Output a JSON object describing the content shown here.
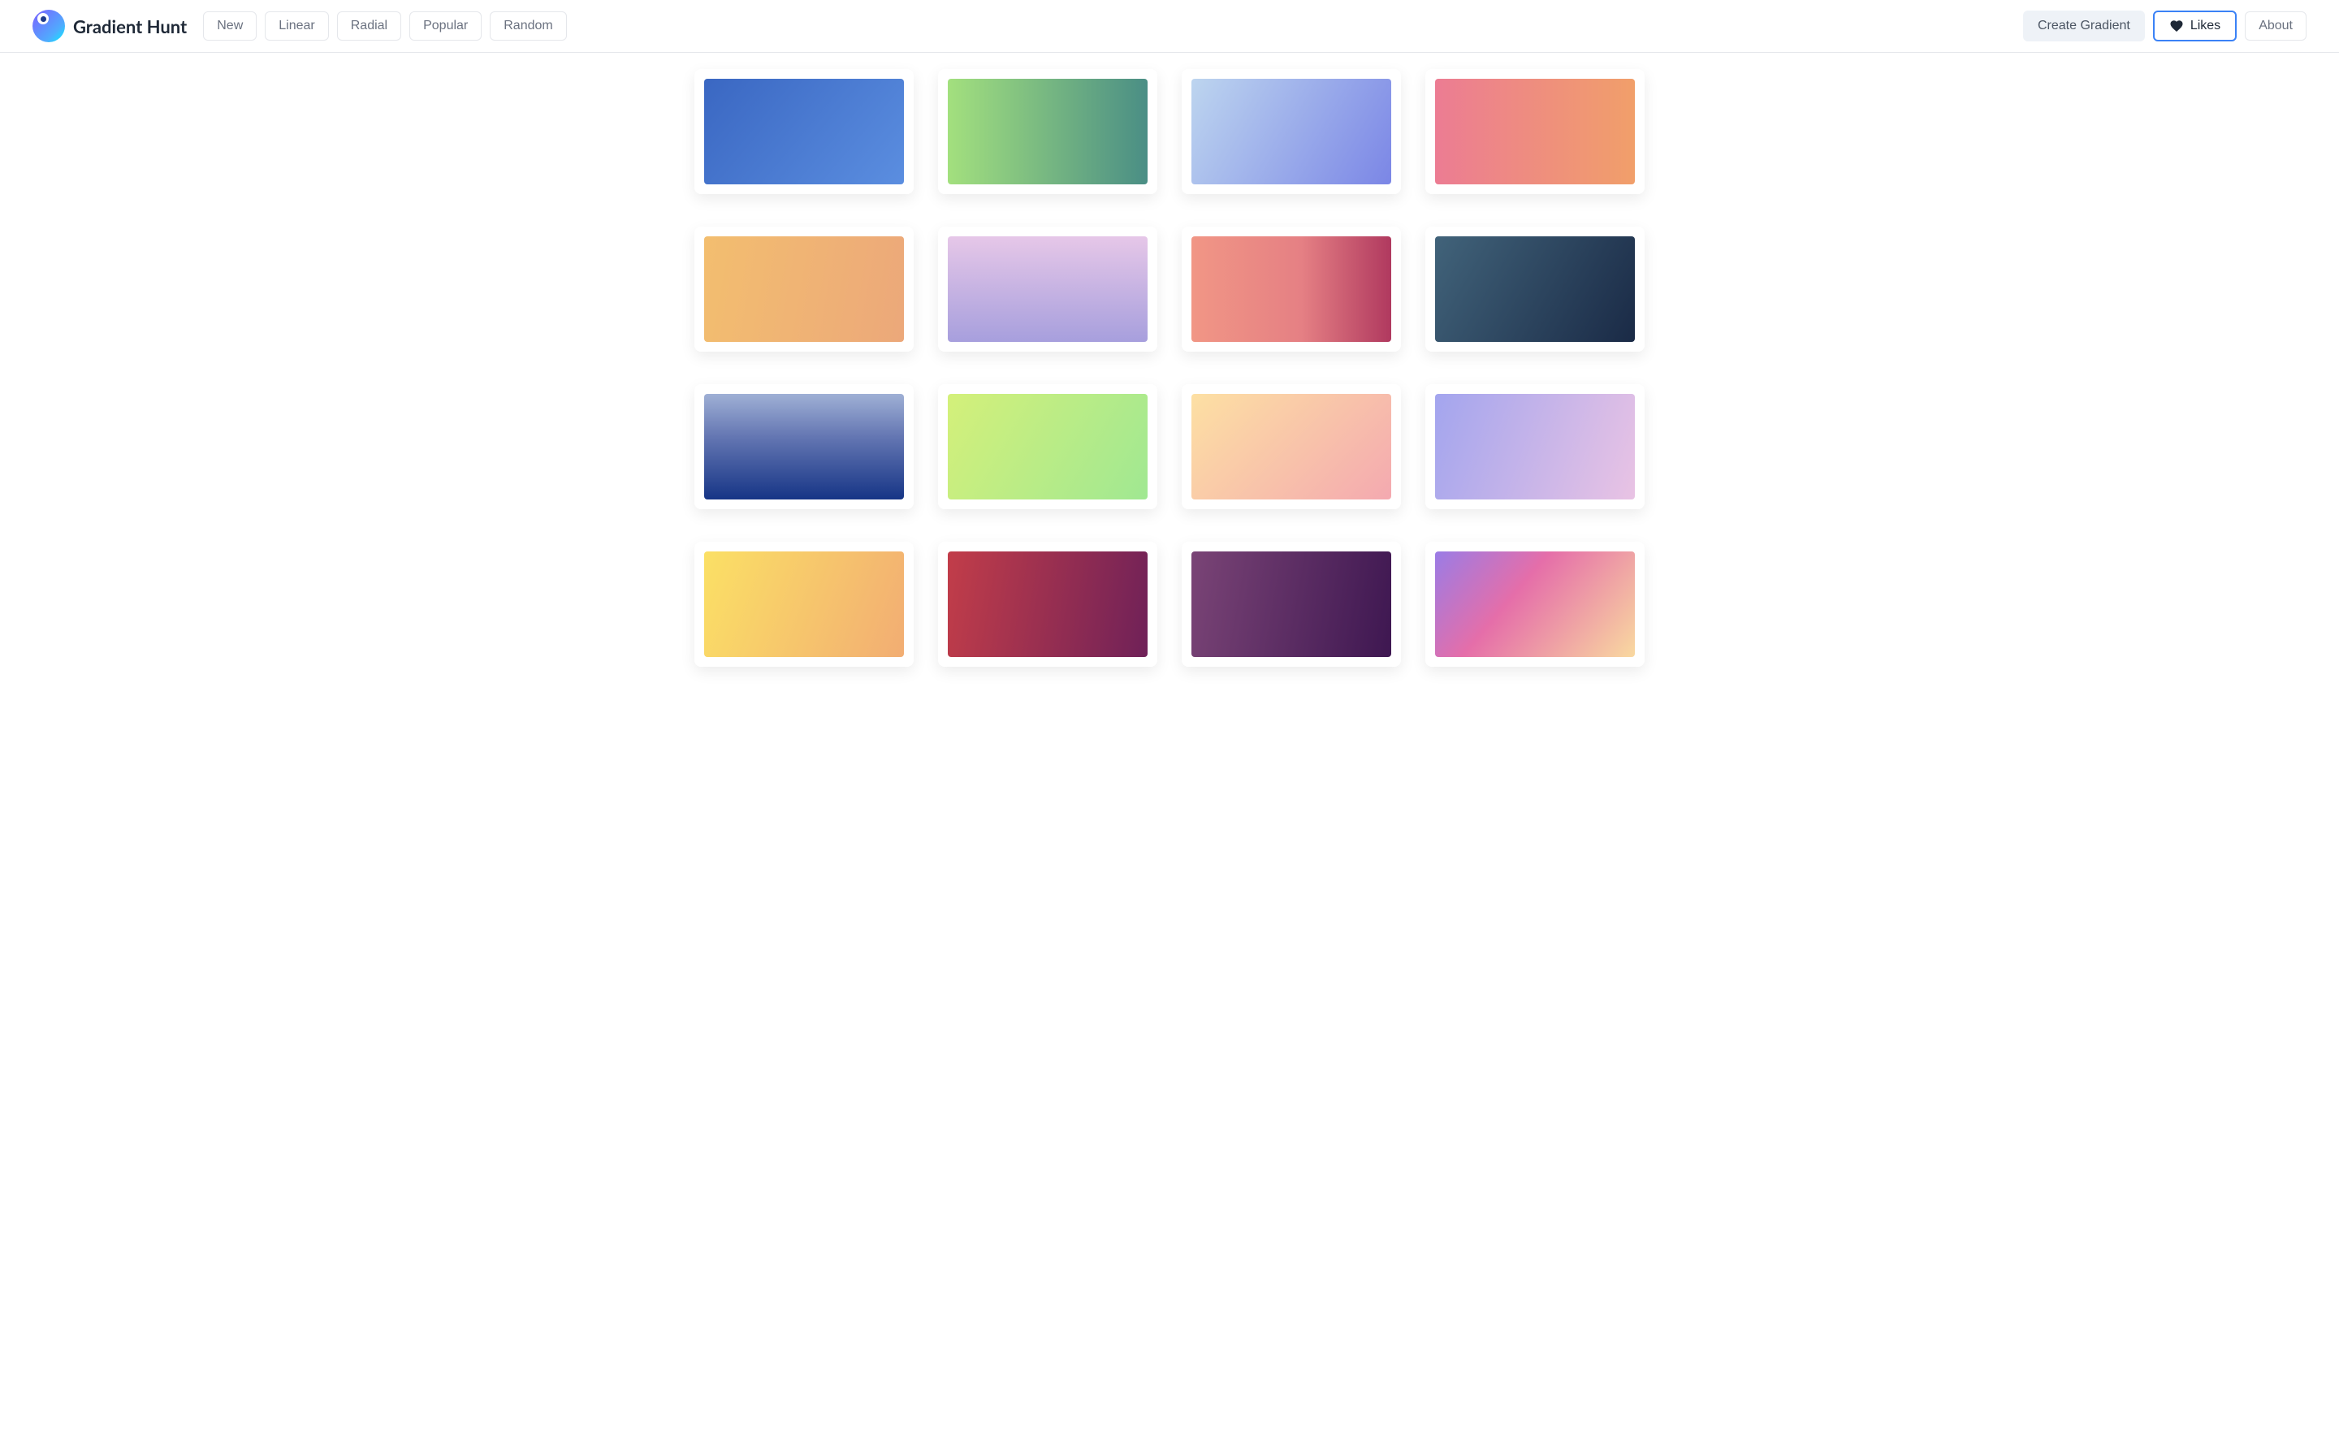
{
  "brand": "Gradient Hunt",
  "nav": {
    "items": [
      "New",
      "Linear",
      "Radial",
      "Popular",
      "Random"
    ]
  },
  "actions": {
    "create": "Create Gradient",
    "likes": "Likes",
    "about": "About"
  },
  "gradients": [
    {
      "css": "linear-gradient(130deg, #3a67c2 0%, #5b8ee0 100%)"
    },
    {
      "css": "linear-gradient(90deg, #a3e07e 0%, #4a8e85 100%)"
    },
    {
      "css": "linear-gradient(120deg, #bdd5ef 0%, #7b86e6 100%)"
    },
    {
      "css": "linear-gradient(90deg, #ec7c93 0%, #f19f6a 100%)"
    },
    {
      "css": "linear-gradient(100deg, #f3be6f 0%, #eca87a 100%)"
    },
    {
      "css": "linear-gradient(180deg, #e6c7e8 0%, #a79fdd 100%)"
    },
    {
      "css": "linear-gradient(90deg, #f19685 0%, #e58084 55%, #b0395f 100%)"
    },
    {
      "css": "linear-gradient(120deg, #41637a 0%, #1a2a46 100%)"
    },
    {
      "css": "linear-gradient(180deg, #9fb0d5 0%, #6577b3 40%, #163586 100%)"
    },
    {
      "css": "linear-gradient(120deg, #d4f07a 0%, #a0e892 100%)"
    },
    {
      "css": "linear-gradient(135deg, #fde0a3 0%, #f4a9b0 100%)"
    },
    {
      "css": "linear-gradient(110deg, #a3a5ee 0%, #e9c3e4 100%)"
    },
    {
      "css": "linear-gradient(110deg, #fbe065 0%, #f2ad73 100%)"
    },
    {
      "css": "linear-gradient(100deg, #c23d49 0%, #6f2158 100%)"
    },
    {
      "css": "linear-gradient(100deg, #7a4476 0%, #3e1751 100%)"
    },
    {
      "css": "linear-gradient(130deg, #9a7ce6 0%, #e56ea9 40%, #f9d9a0 100%)"
    }
  ]
}
